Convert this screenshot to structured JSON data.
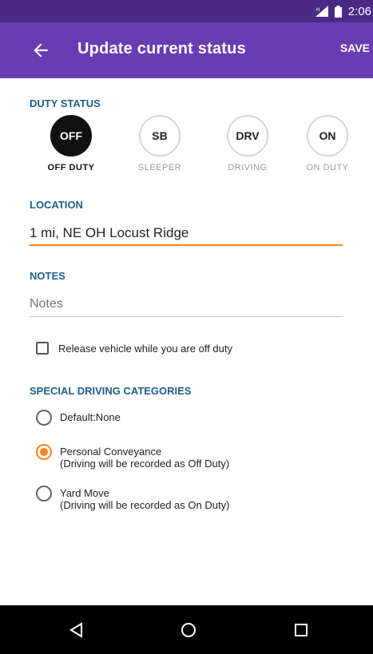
{
  "status_bar": {
    "time": "2:06",
    "signal_icon": "signal-icon",
    "battery_icon": "battery-icon"
  },
  "app_bar": {
    "title": "Update current status",
    "save_label": "SAVE",
    "back_icon": "back-arrow-icon"
  },
  "duty_status": {
    "label": "DUTY STATUS",
    "options": [
      {
        "code": "OFF",
        "label": "OFF DUTY",
        "selected": true
      },
      {
        "code": "SB",
        "label": "SLEEPER",
        "selected": false
      },
      {
        "code": "DRV",
        "label": "DRIVING",
        "selected": false
      },
      {
        "code": "ON",
        "label": "ON DUTY",
        "selected": false
      }
    ]
  },
  "location": {
    "label": "LOCATION",
    "value": "1 mi, NE OH Locust Ridge"
  },
  "notes": {
    "label": "NOTES",
    "placeholder": "Notes",
    "value": ""
  },
  "release_vehicle": {
    "label": "Release vehicle while you are off duty",
    "checked": false
  },
  "special_driving": {
    "label": "SPECIAL DRIVING CATEGORIES",
    "options": [
      {
        "title": "Default:None",
        "subtitle": "",
        "selected": false
      },
      {
        "title": "Personal Conveyance",
        "subtitle": "(Driving will be recorded as Off Duty)",
        "selected": true
      },
      {
        "title": "Yard Move",
        "subtitle": "(Driving will be recorded as On Duty)",
        "selected": false
      }
    ]
  },
  "colors": {
    "status_bar": "#4a2a84",
    "app_bar": "#6a3cb3",
    "section_label": "#1f5d8f",
    "accent": "#f5841f"
  }
}
